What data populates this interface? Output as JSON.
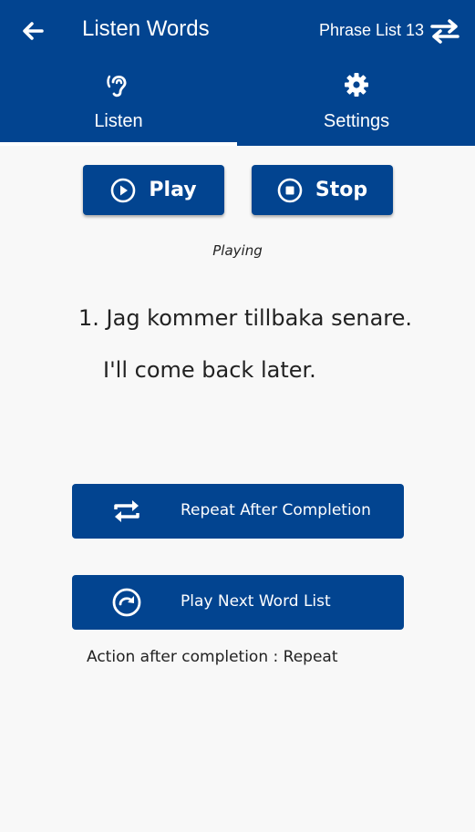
{
  "header": {
    "title": "Listen Words",
    "list_name": "Phrase List 13",
    "back_icon": "arrow-left-icon",
    "swap_icon": "swap-arrows-icon",
    "background": "#024490"
  },
  "tabs": [
    {
      "label": "Listen",
      "icon": "ear-icon",
      "active": true
    },
    {
      "label": "Settings",
      "icon": "gear-icon",
      "active": false
    }
  ],
  "controls": {
    "play_label": "Play",
    "stop_label": "Stop",
    "play_icon": "play-circle-icon",
    "stop_icon": "stop-circle-icon"
  },
  "status": "Playing",
  "current": {
    "phrase": "1. Jag kommer tillbaka senare.",
    "translation": "I'll come back later."
  },
  "actions": {
    "repeat_label": "Repeat After Completion",
    "repeat_icon": "repeat-icon",
    "next_label": "Play Next Word List",
    "next_icon": "redo-circle-icon"
  },
  "completion_text": "Action after completion : Repeat",
  "colors": {
    "accent": "#024490",
    "text": "#222222",
    "background": "#f8f8f8"
  }
}
